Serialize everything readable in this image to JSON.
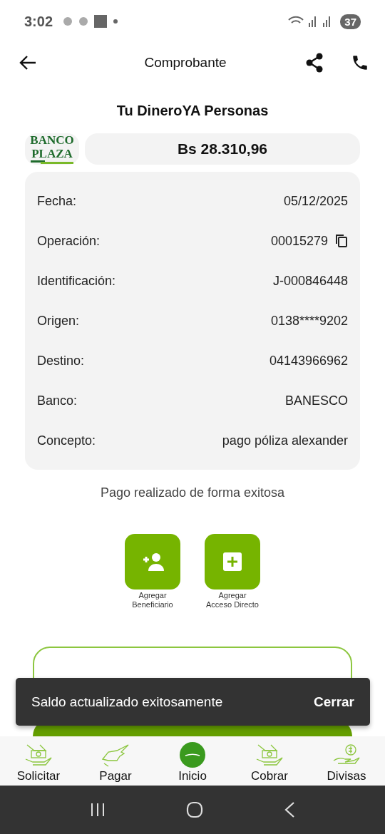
{
  "status_bar": {
    "time": "3:02",
    "battery": "37"
  },
  "header": {
    "title": "Comprobante"
  },
  "heading": "Tu DineroYA Personas",
  "bank_logo": {
    "line_1": "BANCO",
    "line_2": "PLAZA"
  },
  "amount": "Bs 28.310,96",
  "details": [
    {
      "label": "Fecha:",
      "value": "05/12/2025",
      "copyable": false
    },
    {
      "label": "Operación:",
      "value": "00015279",
      "copyable": true
    },
    {
      "label": "Identificación:",
      "value": "J-000846448",
      "copyable": false
    },
    {
      "label": "Origen:",
      "value": "0138****9202",
      "copyable": false
    },
    {
      "label": "Destino:",
      "value": "04143966962",
      "copyable": false
    },
    {
      "label": "Banco:",
      "value": "BANESCO",
      "copyable": false
    },
    {
      "label": "Concepto:",
      "value": "pago póliza alexander",
      "copyable": false
    }
  ],
  "success_message": "Pago realizado de forma exitosa",
  "actions": [
    {
      "kind": "add-person",
      "lines": [
        "Agregar",
        "Beneficiario"
      ]
    },
    {
      "kind": "add-shortcut",
      "lines": [
        "Agregar",
        "Acceso Directo"
      ]
    }
  ],
  "snackbar": {
    "message": "Saldo actualizado exitosamente",
    "action": "Cerrar"
  },
  "bottom_nav": [
    {
      "kind": "request",
      "label": "Solicitar"
    },
    {
      "kind": "pay",
      "label": "Pagar"
    },
    {
      "kind": "home",
      "label": "Inicio"
    },
    {
      "kind": "collect",
      "label": "Cobrar"
    },
    {
      "kind": "currency",
      "label": "Divisas"
    }
  ]
}
